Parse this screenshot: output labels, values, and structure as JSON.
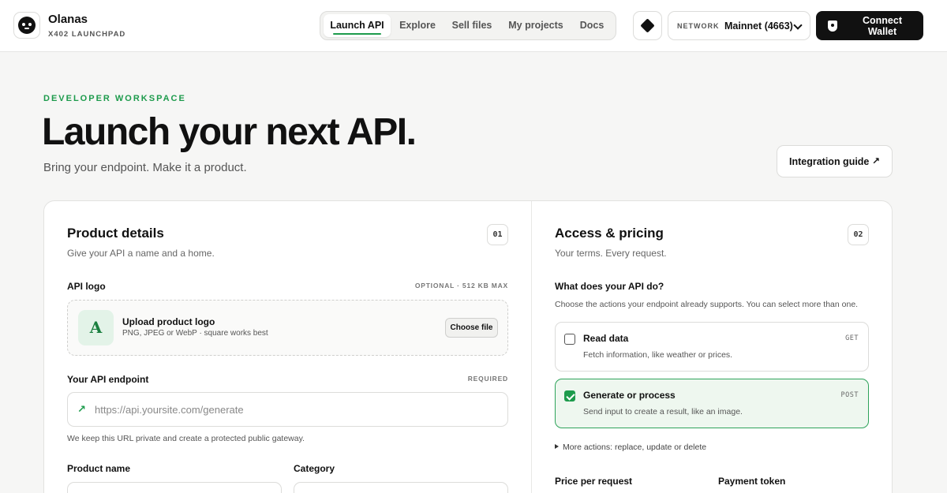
{
  "brand": {
    "name": "Olanas",
    "subtitle": "X402 LAUNCHPAD"
  },
  "nav": {
    "tabs": [
      "Launch API",
      "Explore",
      "Sell files",
      "My projects",
      "Docs"
    ],
    "active_index": 0
  },
  "network": {
    "label": "NETWORK",
    "value": "Mainnet (4663)"
  },
  "connect": {
    "label": "Connect Wallet"
  },
  "hero": {
    "eyebrow": "DEVELOPER WORKSPACE",
    "title": "Launch your next API.",
    "subtitle": "Bring your endpoint. Make it a product.",
    "guide_label": "Integration guide",
    "guide_arrow": "↗"
  },
  "product": {
    "title": "Product details",
    "subtitle": "Give your API a name and a home.",
    "step": "01",
    "logo": {
      "label": "API logo",
      "meta": "OPTIONAL · 512 KB MAX",
      "thumb_letter": "A",
      "upload_title": "Upload product logo",
      "upload_hint": "PNG, JPEG or WebP · square works best",
      "choose_label": "Choose file"
    },
    "endpoint": {
      "label": "Your API endpoint",
      "meta": "REQUIRED",
      "icon": "↗",
      "placeholder": "https://api.yoursite.com/generate",
      "value": "",
      "note": "We keep this URL private and create a protected public gateway."
    },
    "name_label": "Product name",
    "category_label": "Category"
  },
  "access": {
    "title": "Access & pricing",
    "subtitle": "Your terms. Every request.",
    "step": "02",
    "question": "What does your API do?",
    "hint": "Choose the actions your endpoint already supports. You can select more than one.",
    "actions": [
      {
        "title": "Read data",
        "desc": "Fetch information, like weather or prices.",
        "method": "GET",
        "checked": false
      },
      {
        "title": "Generate or process",
        "desc": "Send input to create a result, like an image.",
        "method": "POST",
        "checked": true
      }
    ],
    "more_label": "More actions: replace, update or delete",
    "price_label": "Price per request",
    "token_label": "Payment token"
  },
  "colors": {
    "accent": "#1d9b4c",
    "selected_bg": "#eef7ef",
    "dark": "#111111",
    "page_bg": "#f6f6f5"
  }
}
